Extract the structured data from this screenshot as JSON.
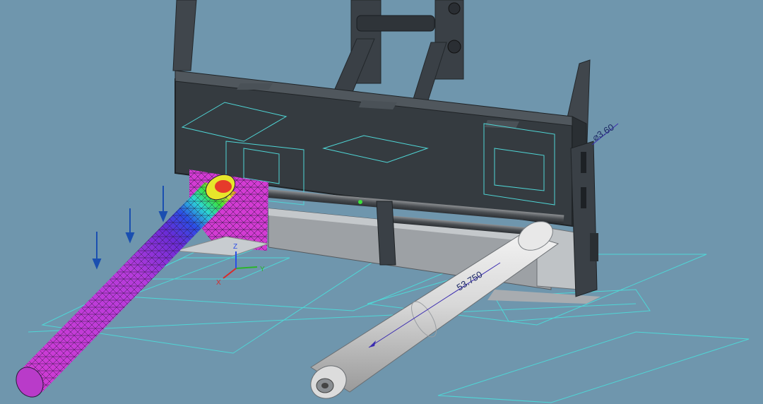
{
  "viewport": {
    "background_color": "#6f96ad",
    "sketch_color": "#4fd6d6",
    "frame_color": "#3a4046",
    "mesh_colors": [
      "#d33bd3",
      "#7a2bd6",
      "#2b4ee6",
      "#2bd6d6",
      "#3be23b",
      "#e6e62b",
      "#e63b2b"
    ],
    "load_arrow_color": "#1a4fb0"
  },
  "dimensions": {
    "length_label": "53.750",
    "diameter_label": "⌀3.60"
  },
  "triad": {
    "x_label": "X",
    "y_label": "Y",
    "z_label": "Z"
  },
  "icons": [
    "triad-icon",
    "load-arrow-icon",
    "dimension-icon"
  ]
}
